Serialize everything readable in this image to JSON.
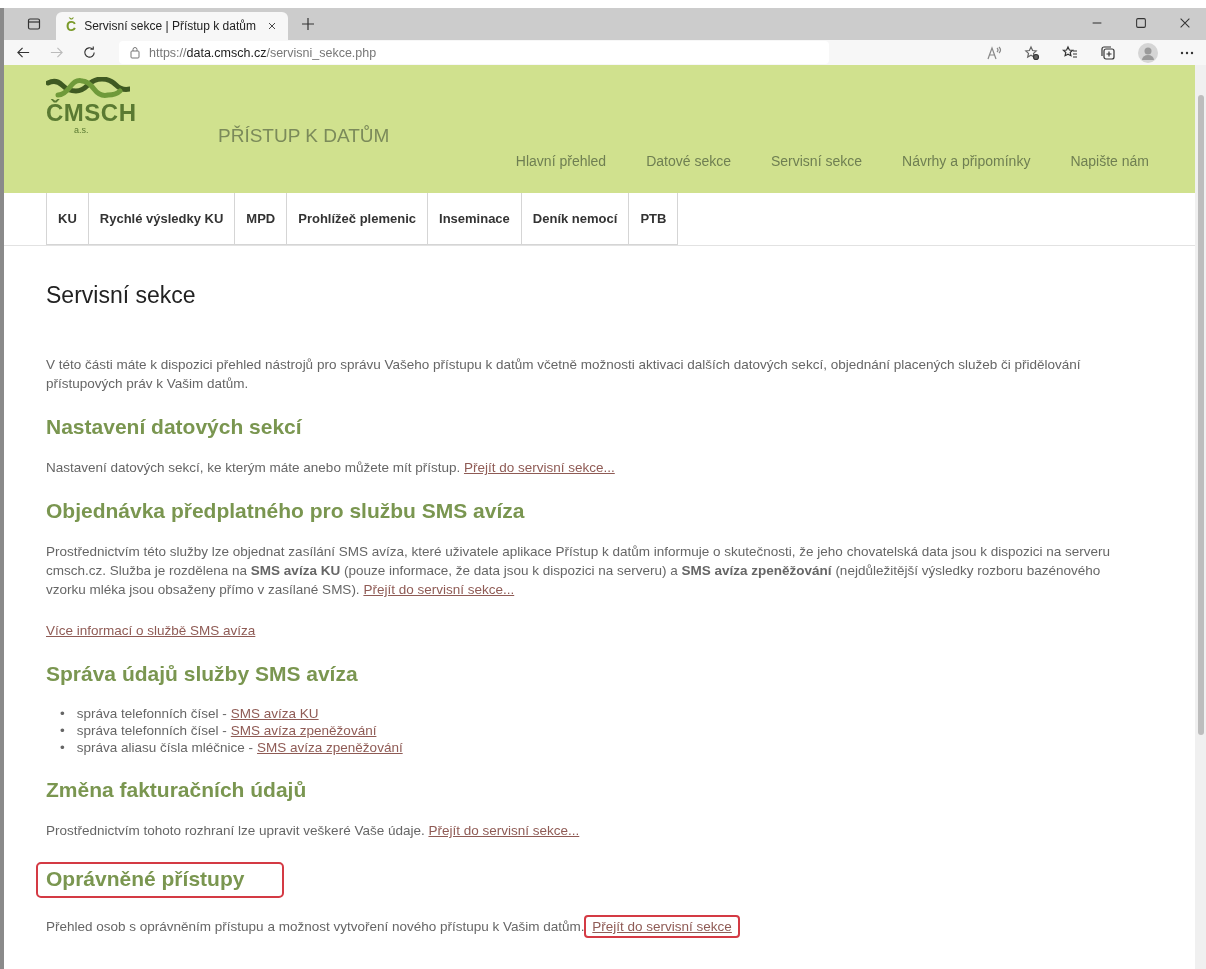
{
  "browser": {
    "tab": {
      "favicon": "Č",
      "title": "Servisní sekce | Přístup k datům",
      "selected": true
    },
    "address": {
      "scheme": "https://",
      "host": "data.cmsch.cz",
      "path": "/servisni_sekce.php"
    }
  },
  "header": {
    "logo": {
      "name": "ČMSCH",
      "suffix": "a.s."
    },
    "title": "PŘÍSTUP K DATŮM",
    "nav": [
      {
        "label": "Hlavní přehled"
      },
      {
        "label": "Datové sekce"
      },
      {
        "label": "Servisní sekce"
      },
      {
        "label": "Návrhy a připomínky"
      },
      {
        "label": "Napište nám"
      }
    ]
  },
  "app_tabs": [
    {
      "label": "KU"
    },
    {
      "label": "Rychlé výsledky KU"
    },
    {
      "label": "MPD"
    },
    {
      "label": "Prohlížeč plemenic"
    },
    {
      "label": "Inseminace"
    },
    {
      "label": "Deník nemocí"
    },
    {
      "label": "PTB"
    }
  ],
  "page_title": "Servisní sekce",
  "intro": "V této části máte k dispozici přehled nástrojů pro správu Vašeho přístupu k datům včetně možnosti aktivaci dalších datových sekcí, objednání placených služeb či přidělování přístupových práv k Vašim datům.",
  "sections": [
    {
      "heading": "Nastavení datových sekcí",
      "highlighted": false,
      "blocks": [
        {
          "kind": "paragraph",
          "text": "Nastavení datových sekcí, ke kterým máte anebo můžete mít přístup.",
          "link": "Přejít do servisní sekce...",
          "link_highlighted": false
        }
      ]
    },
    {
      "heading": "Objednávka předplatného pro službu SMS avíza",
      "highlighted": false,
      "blocks": [
        {
          "kind": "paragraph",
          "text": "Prostřednictvím této služby lze objednat zasílání SMS avíza, které uživatele aplikace Přístup k datům informuje o skutečnosti, že jeho chovatelská data jsou k dispozici na serveru cmsch.cz. Služba je rozdělena na **SMS avíza KU** (pouze informace, že data jsou k dispozici na serveru) a **SMS avíza zpeněžování** (nejdůležitější výsledky rozboru bazénového vzorku mléka jsou obsaženy přímo v zasílané SMS).",
          "link": "Přejít do servisní sekce...",
          "link_highlighted": false
        },
        {
          "kind": "link",
          "link": "Více informací o službě SMS avíza"
        }
      ]
    },
    {
      "heading": "Správa údajů služby SMS avíza",
      "highlighted": false,
      "blocks": [
        {
          "kind": "list",
          "items": [
            {
              "bullet": "•",
              "text": "správa telefonních čísel -",
              "link": "SMS avíza KU"
            },
            {
              "bullet": "•",
              "text": "správa telefonních čísel -",
              "link": "SMS avíza zpeněžování"
            },
            {
              "bullet": "•",
              "text": "správa aliasu čísla mléčnice -",
              "link": "SMS avíza zpeněžování"
            }
          ]
        }
      ]
    },
    {
      "heading": "Změna fakturačních údajů",
      "highlighted": false,
      "blocks": [
        {
          "kind": "paragraph",
          "text": "Prostřednictvím tohoto rozhraní lze upravit veškeré Vaše údaje.",
          "link": "Přejít do servisní sekce...",
          "link_highlighted": false
        }
      ]
    },
    {
      "heading": "Oprávněné přístupy",
      "highlighted": true,
      "blocks": [
        {
          "kind": "paragraph",
          "text": "Přehled osob s oprávněním přístupu a možnost vytvoření nového přístupu k Vašim datům.",
          "link": "Přejít do servisní sekce",
          "link_highlighted": true
        }
      ]
    }
  ]
}
